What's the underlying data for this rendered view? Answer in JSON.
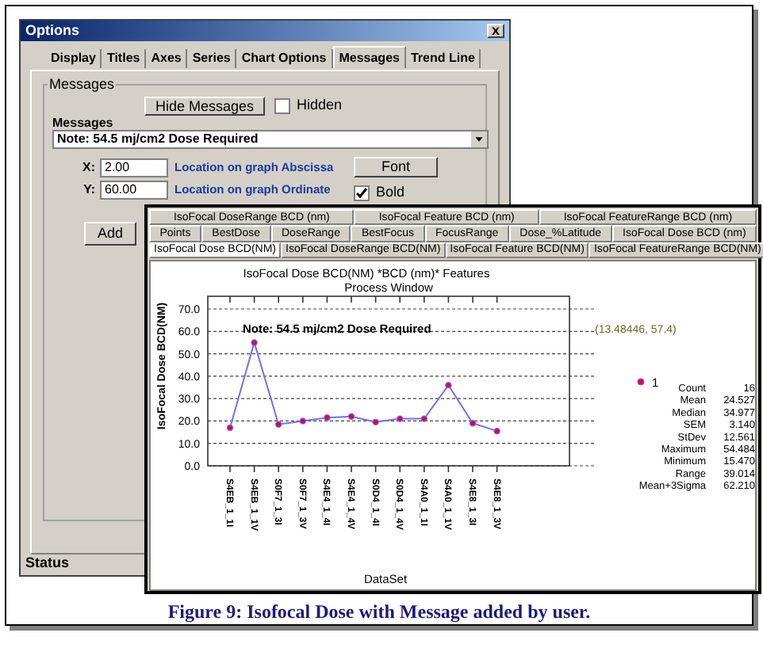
{
  "options_window": {
    "title": "Options",
    "close_label": "x",
    "tabs": [
      {
        "label": "Display",
        "selected": false
      },
      {
        "label": "Titles",
        "selected": false
      },
      {
        "label": "Axes",
        "selected": false
      },
      {
        "label": "Series",
        "selected": false
      },
      {
        "label": "Chart Options",
        "selected": false
      },
      {
        "label": "Messages",
        "selected": true
      },
      {
        "label": "Trend Line",
        "selected": false
      }
    ],
    "group_title": "Messages",
    "hide_button": "Hide Messages",
    "hidden_checkbox": {
      "label": "Hidden",
      "checked": false
    },
    "messages_label": "Messages",
    "message_select": {
      "value": "Note: 54.5 mj/cm2 Dose Required"
    },
    "x_field": {
      "label": "X:",
      "value": "2.00",
      "hint": "Location on graph Abscissa"
    },
    "y_field": {
      "label": "Y:",
      "value": "60.00",
      "hint": "Location on graph Ordinate"
    },
    "font_button": "Font",
    "bold_checkbox": {
      "label": "Bold",
      "checked": true
    },
    "add_button": "Add",
    "status_bar": "Status"
  },
  "chart_window": {
    "tab_rows": [
      {
        "tabs": [
          {
            "label": "IsoFocal DoseRange BCD (nm)",
            "selected": false
          },
          {
            "label": "IsoFocal Feature BCD (nm)",
            "selected": false
          },
          {
            "label": "IsoFocal FeatureRange BCD (nm)",
            "selected": false
          }
        ]
      },
      {
        "tabs": [
          {
            "label": "Points",
            "selected": false
          },
          {
            "label": "BestDose",
            "selected": false
          },
          {
            "label": "DoseRange",
            "selected": false
          },
          {
            "label": "BestFocus",
            "selected": false
          },
          {
            "label": "FocusRange",
            "selected": false
          },
          {
            "label": "Dose_%Latitude",
            "selected": false
          },
          {
            "label": "IsoFocal Dose BCD (nm)",
            "selected": false
          }
        ]
      },
      {
        "tabs": [
          {
            "label": "IsoFocal Dose BCD(NM)",
            "selected": true
          },
          {
            "label": "IsoFocal DoseRange BCD(NM)",
            "selected": false
          },
          {
            "label": "IsoFocal Feature BCD(NM)",
            "selected": false
          },
          {
            "label": "IsoFocal FeatureRange BCD(NM)",
            "selected": false
          }
        ]
      }
    ],
    "subtitle": "Process Window",
    "chart_data": {
      "type": "line",
      "title": "IsoFocal Dose BCD(NM) *BCD (nm)* Features",
      "ylabel": "IsoFocal Dose BCD(NM)",
      "xlabel": "DataSet",
      "categories": [
        "S4EB_1_1I",
        "S4EB_1_1V",
        "S0F7_1_3I",
        "S0F7_1_3V",
        "S4E4_1_4I",
        "S4E4_1_4V",
        "S0D4_1_4I",
        "S0D4_1_4V",
        "S4A0_1_1I",
        "S4A0_1_1V",
        "S4E8_1_3I",
        "S4E8_1_3V"
      ],
      "grid": true,
      "series": [
        {
          "name": "1",
          "color": "#6f6fff",
          "marker": "circle",
          "values": [
            17,
            55,
            18.5,
            20,
            21.5,
            22,
            19.5,
            21,
            21,
            36,
            19,
            15.5
          ]
        }
      ],
      "ylim": [
        0,
        70
      ],
      "yticks": [
        {
          "value": 0,
          "label": "0.0"
        },
        {
          "value": 10,
          "label": "10.0"
        },
        {
          "value": 20,
          "label": "20.0"
        },
        {
          "value": 30,
          "label": "30.0"
        },
        {
          "value": 40,
          "label": "40.0"
        },
        {
          "value": 50,
          "label": "50.0"
        },
        {
          "value": 60,
          "label": "60.0"
        },
        {
          "value": 70,
          "label": "70.0"
        }
      ],
      "annotations": [
        "Note: 54.5 mj/cm2 Dose Required",
        "(13.48446, 57.4)"
      ]
    },
    "stats": [
      {
        "label": "Count",
        "value": "16"
      },
      {
        "label": "Mean",
        "value": "24.527"
      },
      {
        "label": "Median",
        "value": "34.977"
      },
      {
        "label": "SEM",
        "value": "3.140"
      },
      {
        "label": "StDev",
        "value": "12.561"
      },
      {
        "label": "Maximum",
        "value": "54.484"
      },
      {
        "label": "Minimum",
        "value": "15.470"
      },
      {
        "label": "Range",
        "value": "39.014"
      },
      {
        "label": "Mean+3Sigma",
        "value": "62.210"
      }
    ]
  },
  "caption": "Figure 9:  Isofocal Dose with Message added by user."
}
